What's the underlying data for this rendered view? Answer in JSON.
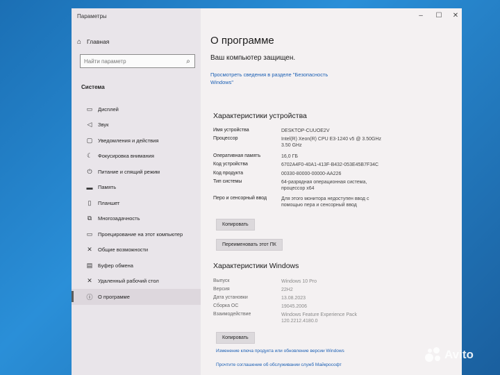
{
  "window": {
    "title": "Параметры"
  },
  "sidebar": {
    "home": "Главная",
    "search_placeholder": "Найти параметр",
    "section": "Система",
    "items": [
      {
        "label": "Дисплей",
        "icon": "display-icon"
      },
      {
        "label": "Звук",
        "icon": "sound-icon"
      },
      {
        "label": "Уведомления и действия",
        "icon": "notifications-icon"
      },
      {
        "label": "Фокусировка внимания",
        "icon": "focus-assist-icon"
      },
      {
        "label": "Питание и спящий режим",
        "icon": "power-icon"
      },
      {
        "label": "Память",
        "icon": "storage-icon"
      },
      {
        "label": "Планшет",
        "icon": "tablet-icon"
      },
      {
        "label": "Многозадачность",
        "icon": "multitasking-icon"
      },
      {
        "label": "Проецирование на этот компьютер",
        "icon": "projecting-icon"
      },
      {
        "label": "Общие возможности",
        "icon": "shared-experiences-icon"
      },
      {
        "label": "Буфер обмена",
        "icon": "clipboard-icon"
      },
      {
        "label": "Удаленный рабочий стол",
        "icon": "remote-desktop-icon"
      },
      {
        "label": "О программе",
        "icon": "info-icon"
      }
    ]
  },
  "main": {
    "title": "О программе",
    "protected": "Ваш компьютер защищен.",
    "security_link": "Просмотреть сведения в разделе \"Безопасность Windows\"",
    "device_heading": "Характеристики устройства",
    "device_specs": [
      {
        "key": "Имя устройства",
        "value": "DESKTOP-CUUOE2V"
      },
      {
        "key": "Процессор",
        "value": "Intel(R) Xeon(R) CPU E3-1240 v5 @ 3.50GHz   3.50 GHz"
      },
      {
        "key": "Оперативная память",
        "value": "16,0 ГБ"
      },
      {
        "key": "Код устройства",
        "value": "6702A4F0-40A1-413F-B432-053E45B7F34C"
      },
      {
        "key": "Код продукта",
        "value": "00330-80000-00000-AA226"
      },
      {
        "key": "Тип системы",
        "value": "64-разрядная операционная система, процессор x64"
      },
      {
        "key": "Перо и сенсорный ввод",
        "value": "Для этого монитора недоступен ввод с помощью пера и сенсорный ввод"
      }
    ],
    "copy_button": "Копировать",
    "rename_button": "Переименовать этот ПК",
    "windows_heading": "Характеристики Windows",
    "windows_specs": [
      {
        "key": "Выпуск",
        "value": "Windows 10 Pro"
      },
      {
        "key": "Версия",
        "value": "22H2"
      },
      {
        "key": "Дата установки",
        "value": "13.08.2023"
      },
      {
        "key": "Сборка ОС",
        "value": "19045.2006"
      },
      {
        "key": "Взаимодействие",
        "value": "Windows Feature Experience Pack 120.2212.4180.0"
      }
    ],
    "copy_button_2": "Копировать",
    "link_change_key": "Изменение ключа продукта или обновление версии Windows",
    "link_agreement": "Прочтите соглашение об обслуживании служб Майкрософт"
  },
  "watermark": {
    "text": "Avito"
  },
  "colors": {
    "link": "#1a5fb4",
    "sidebar_bg": "#e9e5ea",
    "content_bg": "#f4f1f2",
    "desktop": "#2a8fd8"
  }
}
